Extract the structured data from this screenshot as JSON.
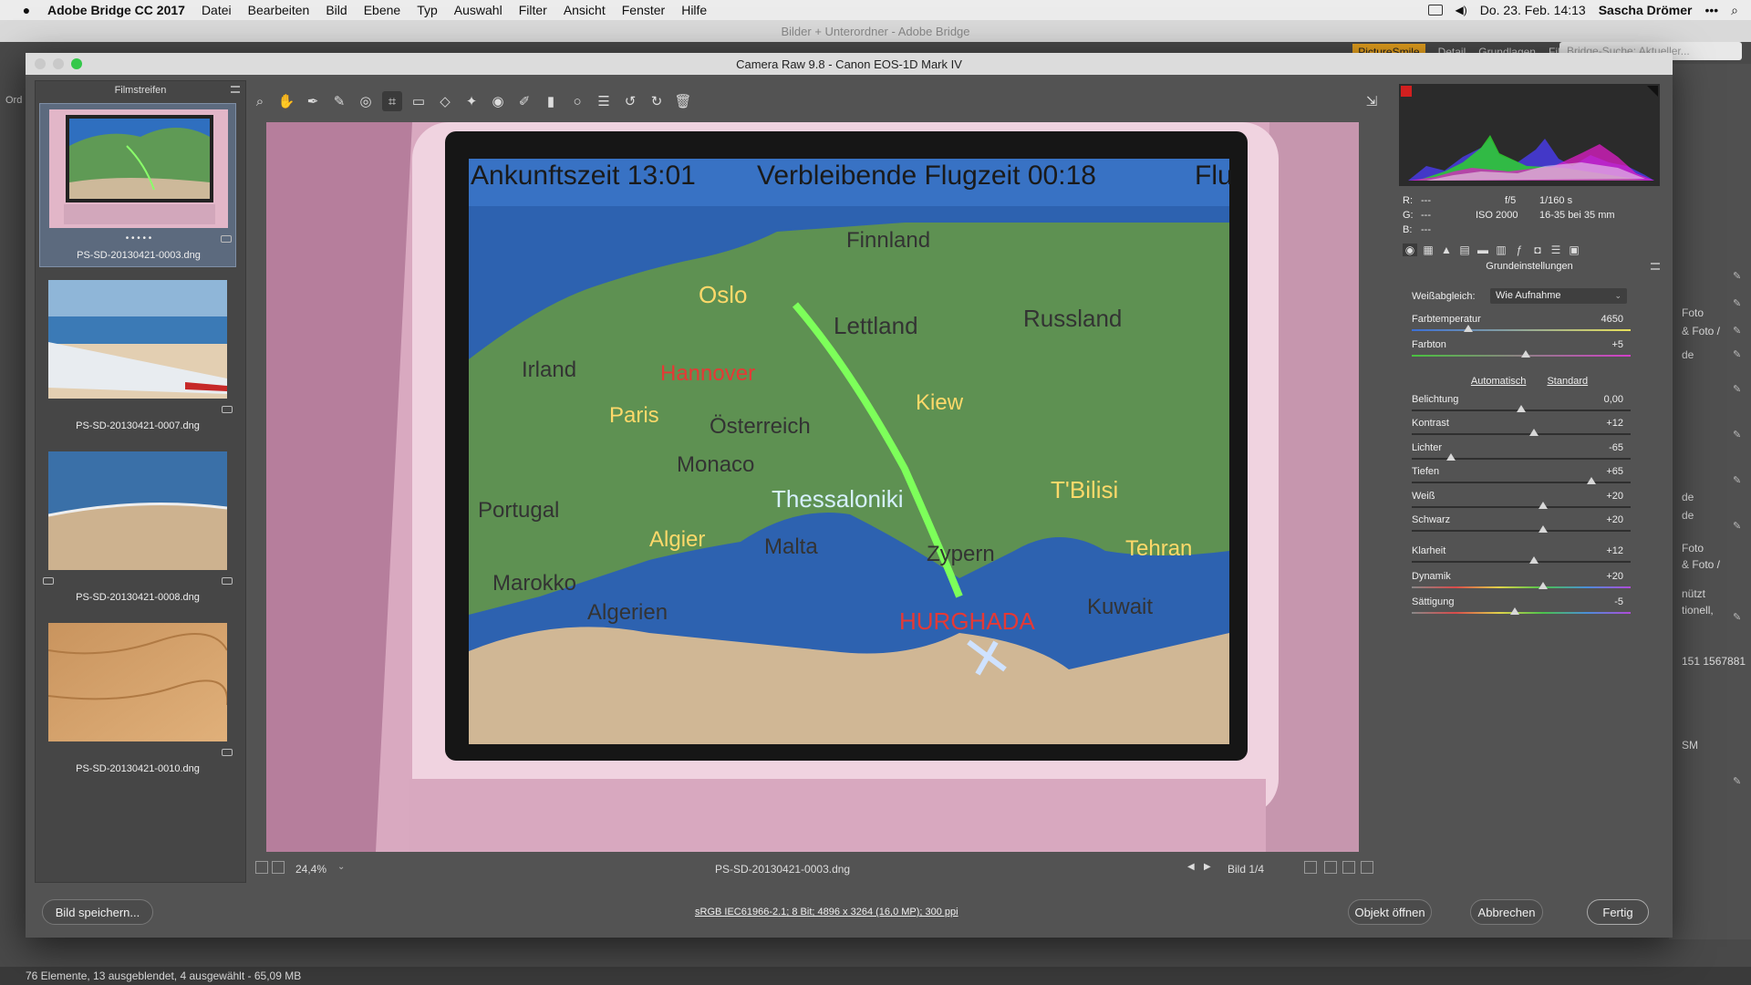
{
  "menubar": {
    "app_name": "Adobe Bridge CC 2017",
    "items": [
      "Datei",
      "Bearbeiten",
      "Bild",
      "Ebene",
      "Typ",
      "Auswahl",
      "Filter",
      "Ansicht",
      "Fenster",
      "Hilfe"
    ],
    "datetime": "Do. 23. Feb. 14:13",
    "user": "Sascha Drömer"
  },
  "bridge": {
    "window_title": "Bilder + Unterordner - Adobe Bridge",
    "tabs": [
      "PictureSmile",
      "Detail",
      "Grundlagen",
      "Filmstreifen"
    ],
    "search_placeholder": "Bridge-Suche: Aktueller...",
    "status": "76 Elemente, 13 ausgeblendet, 4 ausgewählt - 65,09 MB",
    "right_texts": [
      "Foto",
      "& Foto /",
      "de",
      "de",
      "de",
      "Foto",
      "& Foto /",
      "nützt",
      "tionell,",
      "151 1567881",
      "SM"
    ],
    "left_label": "Ord"
  },
  "camera_raw": {
    "title": "Camera Raw 9.8 - Canon EOS-1D Mark IV",
    "filmstrip": {
      "header": "Filmstreifen",
      "items": [
        {
          "name": "PS-SD-20130421-0003.dng",
          "rating": "• • • • •"
        },
        {
          "name": "PS-SD-20130421-0007.dng",
          "rating": ""
        },
        {
          "name": "PS-SD-20130421-0008.dng",
          "rating": ""
        },
        {
          "name": "PS-SD-20130421-0010.dng",
          "rating": ""
        }
      ]
    },
    "preview": {
      "map_header_left": "Ankunftszeit 13:01",
      "map_header_right": "Verbleibende Flugzeit 00:18",
      "map_header_cut": "Flu",
      "labels": [
        "Finnland",
        "Oslo",
        "Lettland",
        "Russland",
        "Irland",
        "Hannover",
        "Paris",
        "Kiew",
        "Österreich",
        "Monaco",
        "Thessaloniki",
        "T'Bilisi",
        "Portugal",
        "Algier",
        "Malta",
        "Zypern",
        "Tehran",
        "Marokko",
        "Algerien",
        "Kuwait",
        "HURGHADA"
      ]
    },
    "bottom": {
      "zoom": "24,4%",
      "filename": "PS-SD-20130421-0003.dng",
      "counter": "Bild 1/4"
    },
    "info": {
      "r": "R:",
      "g": "G:",
      "b": "B:",
      "dashes": "---",
      "aperture": "f/5",
      "shutter": "1/160 s",
      "iso": "ISO 2000",
      "lens": "16-35 bei 35 mm"
    },
    "panel_title": "Grundeinstellungen",
    "white_balance": {
      "label": "Weißabgleich:",
      "value": "Wie Aufnahme"
    },
    "auto_label": "Automatisch",
    "standard_label": "Standard",
    "sliders_top": [
      {
        "name": "Farbtemperatur",
        "value": "4650",
        "pos": 0.26
      },
      {
        "name": "Farbton",
        "value": "+5",
        "pos": 0.52
      }
    ],
    "sliders_tone": [
      {
        "name": "Belichtung",
        "value": "0,00",
        "pos": 0.5
      },
      {
        "name": "Kontrast",
        "value": "+12",
        "pos": 0.56
      },
      {
        "name": "Lichter",
        "value": "-65",
        "pos": 0.18
      },
      {
        "name": "Tiefen",
        "value": "+65",
        "pos": 0.82
      },
      {
        "name": "Weiß",
        "value": "+20",
        "pos": 0.6
      },
      {
        "name": "Schwarz",
        "value": "+20",
        "pos": 0.6
      }
    ],
    "sliders_presence": [
      {
        "name": "Klarheit",
        "value": "+12",
        "pos": 0.56
      },
      {
        "name": "Dynamik",
        "value": "+20",
        "pos": 0.6
      },
      {
        "name": "Sättigung",
        "value": "-5",
        "pos": 0.47
      }
    ],
    "footer": {
      "save": "Bild speichern...",
      "info": "sRGB IEC61966-2.1; 8 Bit; 4896 x 3264 (16,0 MP); 300 ppi",
      "open": "Objekt öffnen",
      "cancel": "Abbrechen",
      "done": "Fertig"
    },
    "colors": {
      "accent": "#e6a11e",
      "selection": "#5c6a7e",
      "route": "#7dff5a"
    }
  }
}
